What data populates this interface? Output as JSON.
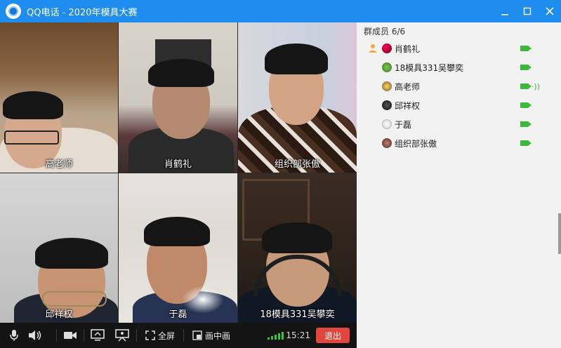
{
  "window": {
    "title": "QQ电话 - 2020年模具大赛",
    "controls": [
      "minimize",
      "maximize",
      "close"
    ]
  },
  "tiles": [
    {
      "name": "高老师"
    },
    {
      "name": "肖鹤礼"
    },
    {
      "name": "组织部张傲"
    },
    {
      "name": "邱祥权"
    },
    {
      "name": "于磊"
    },
    {
      "name": "18模具331吴攀奕"
    }
  ],
  "toolbar": {
    "fullscreen_label": "全屏",
    "pip_label": "画中画",
    "time": "15:21",
    "exit_label": "退出",
    "icons": [
      "microphone-icon",
      "speaker-icon",
      "camera-icon",
      "screen-share-icon",
      "presentation-icon",
      "fullscreen-icon",
      "pip-icon"
    ],
    "colors": {
      "signal": "#3bc43b",
      "exit": "#e0463c"
    }
  },
  "members": {
    "header": "群成员 6/6",
    "list": [
      {
        "name": "肖鹤礼",
        "speaking": false
      },
      {
        "name": "18模具331吴攀奕",
        "speaking": false
      },
      {
        "name": "高老师",
        "speaking": true
      },
      {
        "name": "邱祥权",
        "speaking": false
      },
      {
        "name": "于磊",
        "speaking": false
      },
      {
        "name": "组织部张傲",
        "speaking": false
      }
    ],
    "colors": {
      "camera": "#3cb83c"
    }
  }
}
